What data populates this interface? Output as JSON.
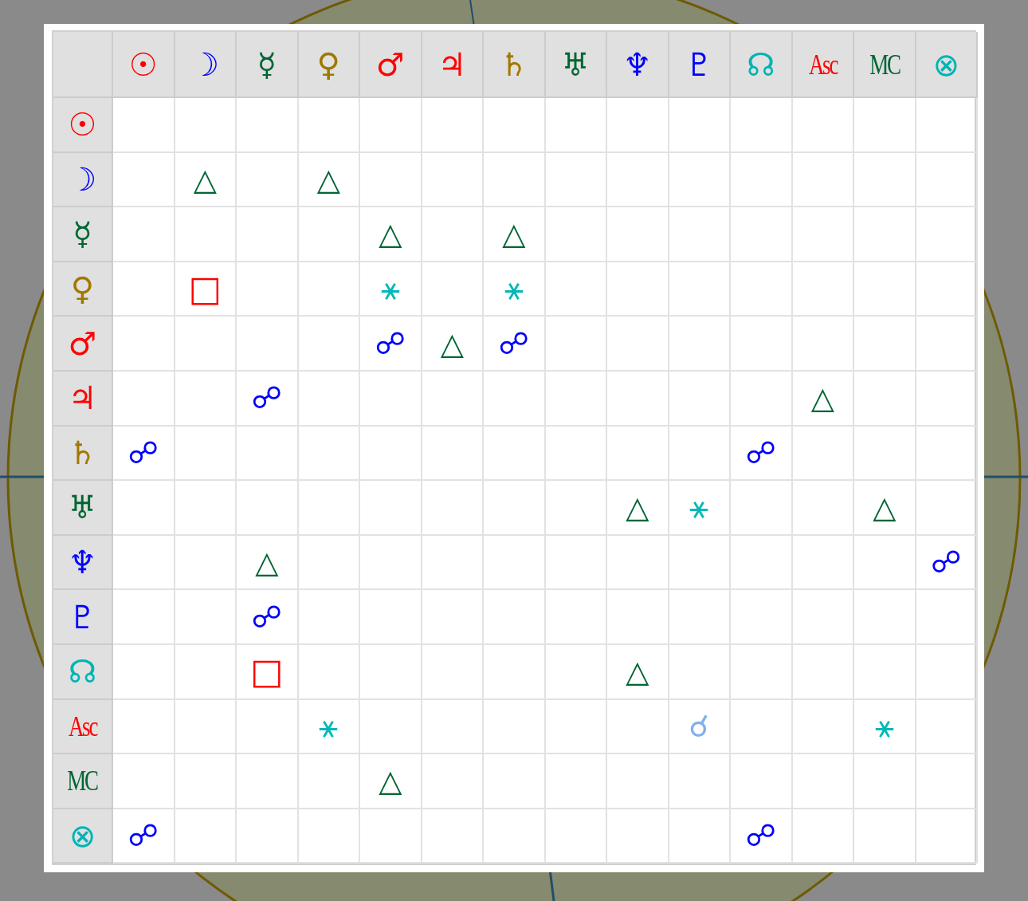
{
  "columns": [
    {
      "symbol": "☉",
      "color": "#ff0000"
    },
    {
      "symbol": "☽",
      "color": "#0000ff"
    },
    {
      "symbol": "☿",
      "color": "#006633"
    },
    {
      "symbol": "♀",
      "color": "#a07800"
    },
    {
      "symbol": "♂",
      "color": "#ff0000"
    },
    {
      "symbol": "♃",
      "color": "#ff0000"
    },
    {
      "symbol": "♄",
      "color": "#a07800"
    },
    {
      "symbol": "♅",
      "color": "#006633"
    },
    {
      "symbol": "♆",
      "color": "#0000ff"
    },
    {
      "symbol": "♇",
      "color": "#0000ff"
    },
    {
      "symbol": "☊",
      "color": "#00b4b4"
    },
    {
      "symbol": "Asc",
      "color": "#ff0000"
    },
    {
      "symbol": "MC",
      "color": "#006633"
    },
    {
      "symbol": "⊗",
      "color": "#00b4b4"
    }
  ],
  "rows": [
    {
      "symbol": "☉",
      "color": "#ff0000",
      "cells": [
        null,
        null,
        null,
        null,
        null,
        null,
        null,
        null,
        null,
        null,
        null,
        null,
        null,
        null
      ]
    },
    {
      "symbol": "☽",
      "color": "#0000ff",
      "cells": [
        null,
        {
          "symbol": "△",
          "kind": "trine"
        },
        null,
        {
          "symbol": "△",
          "kind": "trine"
        },
        null,
        null,
        null,
        null,
        null,
        null,
        null,
        null,
        null,
        null
      ]
    },
    {
      "symbol": "☿",
      "color": "#006633",
      "cells": [
        null,
        null,
        null,
        null,
        {
          "symbol": "△",
          "kind": "trine"
        },
        null,
        {
          "symbol": "△",
          "kind": "trine"
        },
        null,
        null,
        null,
        null,
        null,
        null,
        null
      ]
    },
    {
      "symbol": "♀",
      "color": "#a07800",
      "cells": [
        null,
        {
          "symbol": "□",
          "kind": "square"
        },
        null,
        null,
        {
          "symbol": "⚹",
          "kind": "sextile"
        },
        null,
        {
          "symbol": "⚹",
          "kind": "sextile"
        },
        null,
        null,
        null,
        null,
        null,
        null,
        null
      ]
    },
    {
      "symbol": "♂",
      "color": "#ff0000",
      "cells": [
        null,
        null,
        null,
        null,
        {
          "symbol": "☍",
          "kind": "opposition"
        },
        {
          "symbol": "△",
          "kind": "trine"
        },
        {
          "symbol": "☍",
          "kind": "opposition"
        },
        null,
        null,
        null,
        null,
        null,
        null,
        null
      ]
    },
    {
      "symbol": "♃",
      "color": "#ff0000",
      "cells": [
        null,
        null,
        {
          "symbol": "☍",
          "kind": "opposition"
        },
        null,
        null,
        null,
        null,
        null,
        null,
        null,
        null,
        {
          "symbol": "△",
          "kind": "trine"
        },
        null,
        null
      ]
    },
    {
      "symbol": "♄",
      "color": "#a07800",
      "cells": [
        {
          "symbol": "☍",
          "kind": "opposition"
        },
        null,
        null,
        null,
        null,
        null,
        null,
        null,
        null,
        null,
        {
          "symbol": "☍",
          "kind": "opposition"
        },
        null,
        null,
        null
      ]
    },
    {
      "symbol": "♅",
      "color": "#006633",
      "cells": [
        null,
        null,
        null,
        null,
        null,
        null,
        null,
        null,
        {
          "symbol": "△",
          "kind": "trine"
        },
        {
          "symbol": "⚹",
          "kind": "sextile"
        },
        null,
        null,
        {
          "symbol": "△",
          "kind": "trine"
        },
        null
      ]
    },
    {
      "symbol": "♆",
      "color": "#0000ff",
      "cells": [
        null,
        null,
        {
          "symbol": "△",
          "kind": "trine"
        },
        null,
        null,
        null,
        null,
        null,
        null,
        null,
        null,
        null,
        null,
        {
          "symbol": "☍",
          "kind": "opposition"
        }
      ]
    },
    {
      "symbol": "♇",
      "color": "#0000ff",
      "cells": [
        null,
        null,
        {
          "symbol": "☍",
          "kind": "opposition"
        },
        null,
        null,
        null,
        null,
        null,
        null,
        null,
        null,
        null,
        null,
        null
      ]
    },
    {
      "symbol": "☊",
      "color": "#00b4b4",
      "cells": [
        null,
        null,
        {
          "symbol": "□",
          "kind": "square"
        },
        null,
        null,
        null,
        null,
        null,
        {
          "symbol": "△",
          "kind": "trine"
        },
        null,
        null,
        null,
        null,
        null
      ]
    },
    {
      "symbol": "Asc",
      "color": "#ff0000",
      "cells": [
        null,
        null,
        null,
        {
          "symbol": "⚹",
          "kind": "sextile"
        },
        null,
        null,
        null,
        null,
        null,
        {
          "symbol": "☌",
          "kind": "conjunction"
        },
        null,
        null,
        {
          "symbol": "⚹",
          "kind": "sextile"
        },
        null
      ]
    },
    {
      "symbol": "MC",
      "color": "#006633",
      "cells": [
        null,
        null,
        null,
        null,
        {
          "symbol": "△",
          "kind": "trine"
        },
        null,
        null,
        null,
        null,
        null,
        null,
        null,
        null,
        null
      ]
    },
    {
      "symbol": "⊗",
      "color": "#00b4b4",
      "cells": [
        {
          "symbol": "☍",
          "kind": "opposition"
        },
        null,
        null,
        null,
        null,
        null,
        null,
        null,
        null,
        null,
        {
          "symbol": "☍",
          "kind": "opposition"
        },
        null,
        null,
        null
      ]
    }
  ]
}
